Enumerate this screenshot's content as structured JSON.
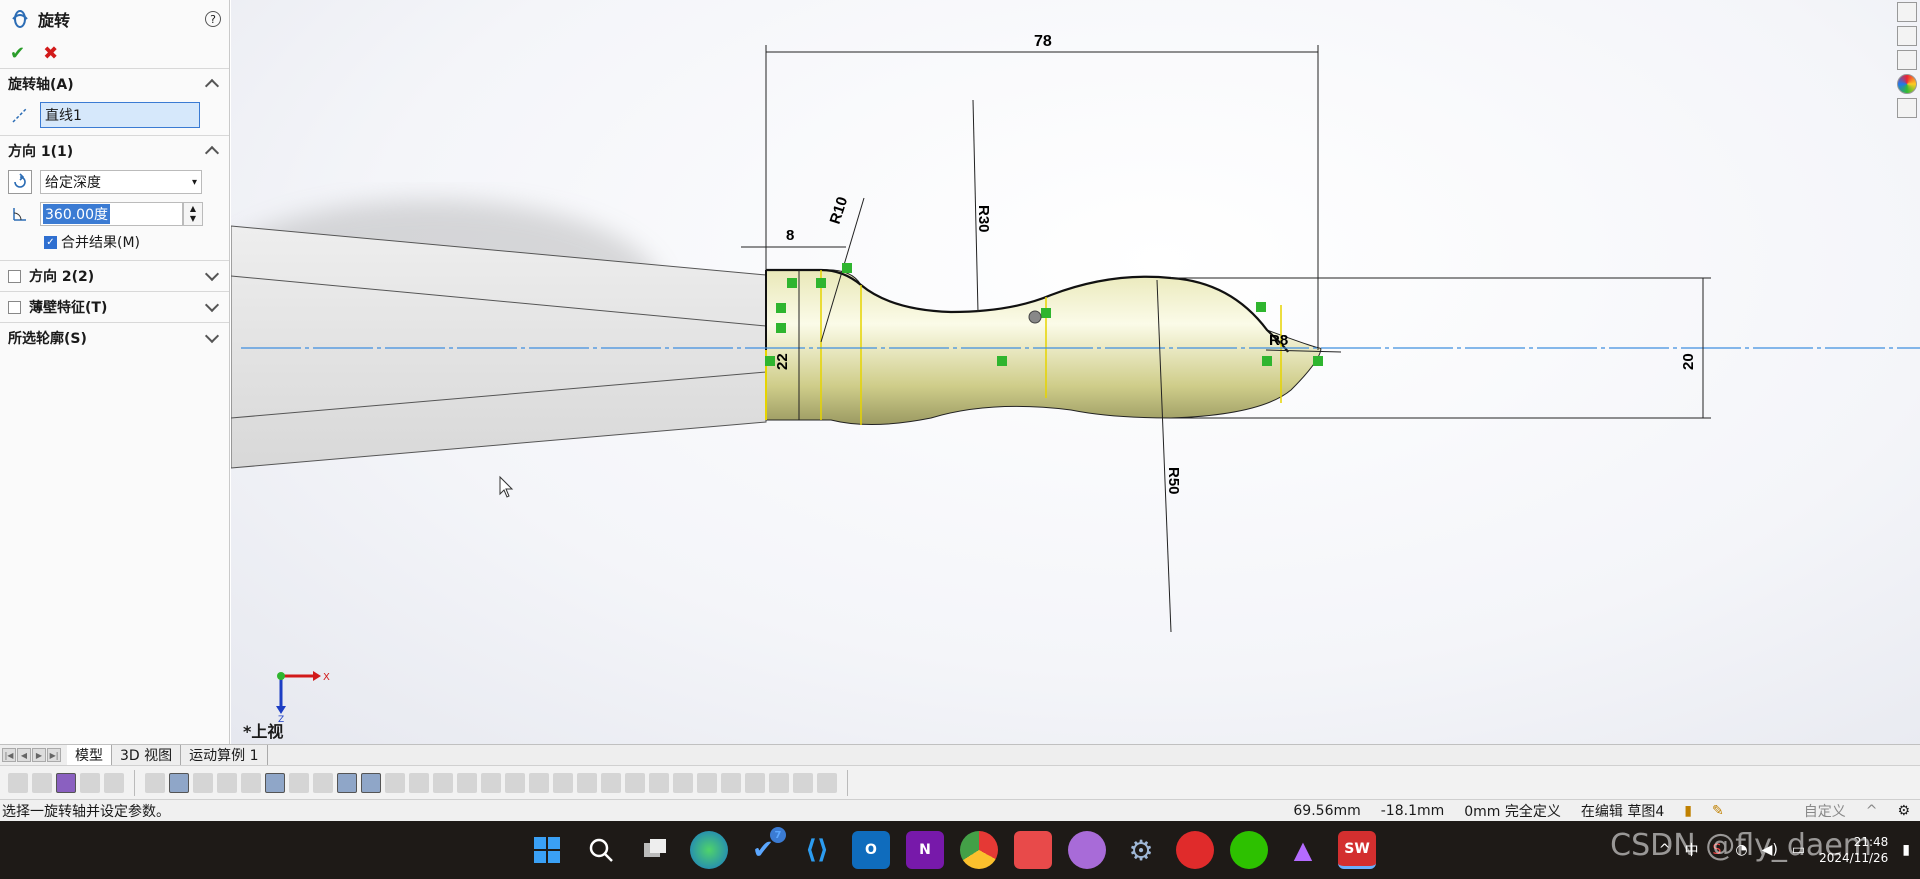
{
  "property_manager": {
    "title": "旋转",
    "help_icon": "?",
    "axis_section": {
      "label": "旋转轴(A)",
      "value": "直线1"
    },
    "direction1": {
      "label": "方向 1(1)",
      "end_condition": "给定深度",
      "angle": "360.00度",
      "merge_label": "合并结果(M)",
      "merge_checked": true
    },
    "direction2": {
      "label": "方向 2(2)"
    },
    "thin": {
      "label": "薄壁特征(T)"
    },
    "contours": {
      "label": "所选轮廓(S)"
    }
  },
  "viewport": {
    "view_name": "*上视",
    "triad": {
      "x": "X",
      "z": "Z"
    },
    "dimensions": {
      "overall_length": "78",
      "neck": "8",
      "r10": "R10",
      "r30": "R30",
      "r50": "R50",
      "r8": "R8",
      "height22": "22",
      "height20": "20"
    }
  },
  "tabs": [
    "模型",
    "3D 视图",
    "运动算例 1"
  ],
  "status": {
    "message": "选择一旋转轴并设定参数。",
    "x": "69.56mm",
    "y": "-18.1mm",
    "z_state": "0mm 完全定义",
    "editing": "在编辑 草图4",
    "custom": "自定义"
  },
  "taskbar": {
    "apps": [
      "start",
      "search",
      "task-view",
      "edge",
      "todo",
      "vscode",
      "outlook",
      "onenote",
      "chrome",
      "app-red",
      "app-cat",
      "settings",
      "netease-music",
      "wechat",
      "app-triangle",
      "solidworks"
    ],
    "todo_badge": "7",
    "solidworks_label": "SW",
    "ime": "中",
    "time": "21:48",
    "date": "2024/11/26",
    "watermark": "CSDN @fly_daem"
  }
}
